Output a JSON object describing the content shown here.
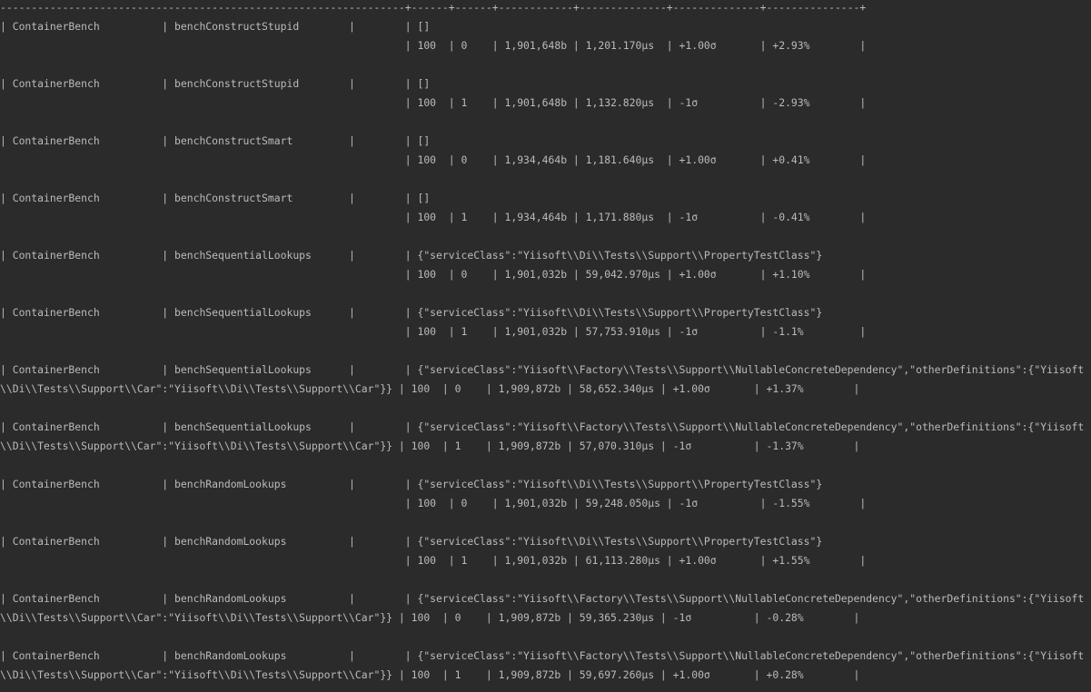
{
  "terminal": {
    "lines": [
      "-----------------------------------------------------------------+------+------+------------+--------------+--------------+---------------+",
      "| ContainerBench          | benchConstructStupid        |        | []",
      "                                                                 | 100  | 0    | 1,901,648b | 1,201.170µs  | +1.00σ       | +2.93%        |",
      "| ContainerBench          | benchConstructStupid        |        | []",
      "                                                                 | 100  | 1    | 1,901,648b | 1,132.820µs  | -1σ          | -2.93%        |",
      "| ContainerBench          | benchConstructSmart         |        | []",
      "                                                                 | 100  | 0    | 1,934,464b | 1,181.640µs  | +1.00σ       | +0.41%        |",
      "| ContainerBench          | benchConstructSmart         |        | []",
      "                                                                 | 100  | 1    | 1,934,464b | 1,171.880µs  | -1σ          | -0.41%        |",
      "| ContainerBench          | benchSequentialLookups      |        | {\"serviceClass\":\"Yiisoft\\\\Di\\\\Tests\\\\Support\\\\PropertyTestClass\"}",
      "                                                                 | 100  | 0    | 1,901,032b | 59,042.970µs | +1.00σ       | +1.10%        |",
      "| ContainerBench          | benchSequentialLookups      |        | {\"serviceClass\":\"Yiisoft\\\\Di\\\\Tests\\\\Support\\\\PropertyTestClass\"}",
      "                                                                 | 100  | 1    | 1,901,032b | 57,753.910µs | -1σ          | -1.1%         |",
      "| ContainerBench          | benchSequentialLookups      |        | {\"serviceClass\":\"Yiisoft\\\\Factory\\\\Tests\\\\Support\\\\NullableConcreteDependency\",\"otherDefinitions\":{\"Yiisoft",
      "\\\\Di\\\\Tests\\\\Support\\\\Car\":\"Yiisoft\\\\Di\\\\Tests\\\\Support\\\\Car\"}} | 100  | 0    | 1,909,872b | 58,652.340µs | +1.00σ       | +1.37%        |",
      "| ContainerBench          | benchSequentialLookups      |        | {\"serviceClass\":\"Yiisoft\\\\Factory\\\\Tests\\\\Support\\\\NullableConcreteDependency\",\"otherDefinitions\":{\"Yiisoft",
      "\\\\Di\\\\Tests\\\\Support\\\\Car\":\"Yiisoft\\\\Di\\\\Tests\\\\Support\\\\Car\"}} | 100  | 1    | 1,909,872b | 57,070.310µs | -1σ          | -1.37%        |",
      "| ContainerBench          | benchRandomLookups          |        | {\"serviceClass\":\"Yiisoft\\\\Di\\\\Tests\\\\Support\\\\PropertyTestClass\"}",
      "                                                                 | 100  | 0    | 1,901,032b | 59,248.050µs | -1σ          | -1.55%        |",
      "| ContainerBench          | benchRandomLookups          |        | {\"serviceClass\":\"Yiisoft\\\\Di\\\\Tests\\\\Support\\\\PropertyTestClass\"}",
      "                                                                 | 100  | 1    | 1,901,032b | 61,113.280µs | +1.00σ       | +1.55%        |",
      "| ContainerBench          | benchRandomLookups          |        | {\"serviceClass\":\"Yiisoft\\\\Factory\\\\Tests\\\\Support\\\\NullableConcreteDependency\",\"otherDefinitions\":{\"Yiisoft",
      "\\\\Di\\\\Tests\\\\Support\\\\Car\":\"Yiisoft\\\\Di\\\\Tests\\\\Support\\\\Car\"}} | 100  | 0    | 1,909,872b | 59,365.230µs | -1σ          | -0.28%        |",
      "| ContainerBench          | benchRandomLookups          |        | {\"serviceClass\":\"Yiisoft\\\\Factory\\\\Tests\\\\Support\\\\NullableConcreteDependency\",\"otherDefinitions\":{\"Yiisoft",
      "\\\\Di\\\\Tests\\\\Support\\\\Car\":\"Yiisoft\\\\Di\\\\Tests\\\\Support\\\\Car\"}} | 100  | 1    | 1,909,872b | 59,697.260µs | +1.00σ       | +0.28%        |"
    ]
  }
}
